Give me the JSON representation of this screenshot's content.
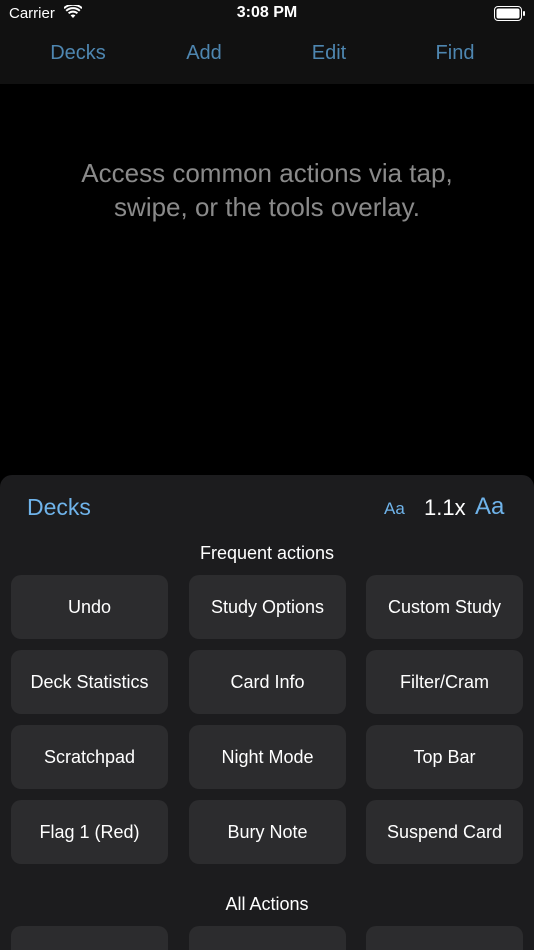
{
  "status_bar": {
    "carrier": "Carrier",
    "time": "3:08 PM"
  },
  "nav": {
    "decks": "Decks",
    "add": "Add",
    "edit": "Edit",
    "find": "Find"
  },
  "main": {
    "message": "Access common actions via tap, swipe, or the tools overlay."
  },
  "sheet": {
    "title": "Decks",
    "font_small": "Aa",
    "zoom": "1.1x",
    "font_large": "Aa",
    "frequent_header": "Frequent actions",
    "all_header": "All Actions",
    "actions": [
      "Undo",
      "Study Options",
      "Custom Study",
      "Deck Statistics",
      "Card Info",
      "Filter/Cram",
      "Scratchpad",
      "Night Mode",
      "Top Bar",
      "Flag 1 (Red)",
      "Bury Note",
      "Suspend Card"
    ]
  },
  "colors": {
    "accent": "#6fb3ea",
    "nav_link": "#4e86b0",
    "background": "#000000",
    "sheet": "#1c1c1e",
    "button": "#2c2c2e"
  }
}
